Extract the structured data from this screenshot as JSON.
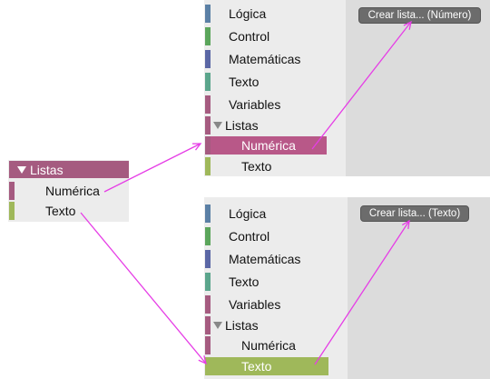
{
  "colors": {
    "logica": "#5b80a5",
    "control": "#5ba55b",
    "matematicas": "#5b67a5",
    "texto_cat": "#5ba58c",
    "variables": "#a55b80",
    "listas": "#a55b80",
    "numerica_selected": "#b85888",
    "texto_selected": "#9fb85a",
    "arrow": "#e63de6"
  },
  "small_toolbox": {
    "header": "Listas",
    "items": [
      {
        "label": "Numérica"
      },
      {
        "label": "Texto"
      }
    ]
  },
  "toolbox_top": {
    "items": [
      {
        "label": "Lógica"
      },
      {
        "label": "Control"
      },
      {
        "label": "Matemáticas"
      },
      {
        "label": "Texto"
      },
      {
        "label": "Variables"
      },
      {
        "label": "Listas"
      },
      {
        "label": "Numérica"
      },
      {
        "label": "Texto"
      }
    ],
    "flyout_button": "Crear lista... (Número)"
  },
  "toolbox_bottom": {
    "items": [
      {
        "label": "Lógica"
      },
      {
        "label": "Control"
      },
      {
        "label": "Matemáticas"
      },
      {
        "label": "Texto"
      },
      {
        "label": "Variables"
      },
      {
        "label": "Listas"
      },
      {
        "label": "Numérica"
      },
      {
        "label": "Texto"
      }
    ],
    "flyout_button": "Crear lista... (Texto)"
  }
}
